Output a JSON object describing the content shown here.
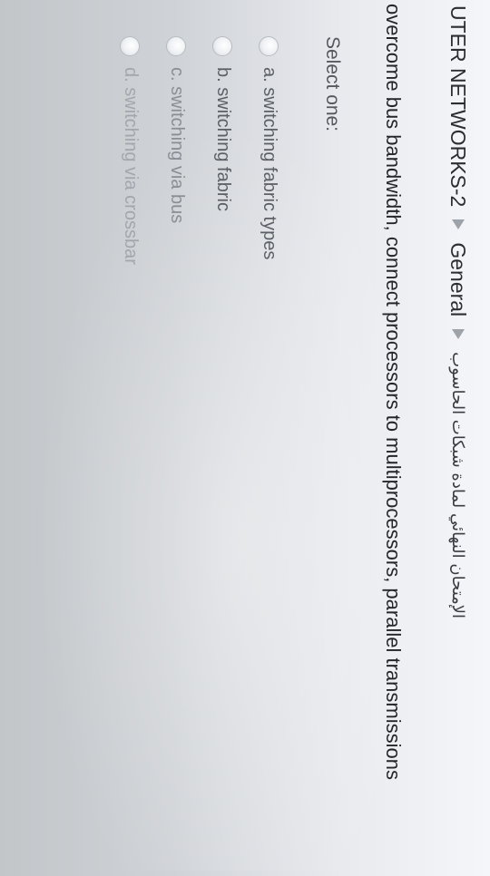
{
  "breadcrumb": {
    "course": "UTER NETWORKS-2",
    "section": "General",
    "exam": "الإمتحان النهائي لمادة شبكات الحاسوب"
  },
  "question": {
    "text": "overcome bus bandwidth, connect processors to multiprocessors, parallel transmissions"
  },
  "answer": {
    "prompt": "Select one:",
    "options": [
      {
        "label": "a. switching fabric types",
        "selected": false
      },
      {
        "label": "b. switching fabric",
        "selected": false
      },
      {
        "label": "c. switching via bus",
        "selected": false
      },
      {
        "label": "d. switching via crossbar",
        "selected": false
      }
    ]
  },
  "colors": {
    "text": "#25262a",
    "option_text": "#5c5f66",
    "separator": "#9ea3aa"
  }
}
